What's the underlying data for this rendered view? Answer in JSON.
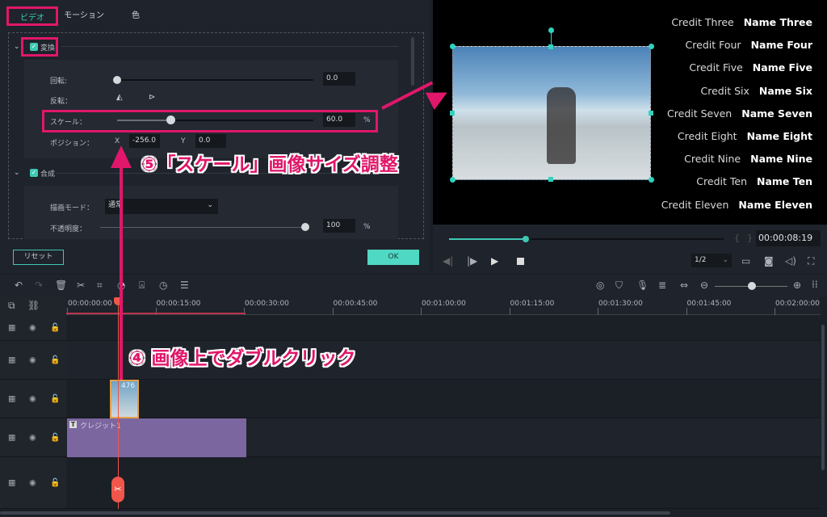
{
  "tabs": [
    "ビデオ",
    "モーション",
    "色"
  ],
  "transform": {
    "label": "変換",
    "rotation_label": "回転:",
    "rotation_value": "0.0",
    "flip_label": "反転：",
    "scale_label": "スケール：",
    "scale_value": "60.0",
    "scale_unit": "%",
    "scale_fraction": 0.31,
    "position_label": "ポジション：",
    "x_label": "X",
    "x_value": "-256.0",
    "y_label": "Y",
    "y_value": "0.0"
  },
  "composite": {
    "label": "合成",
    "blend_label": "描画モード：",
    "blend_value": "通常",
    "opacity_label": "不透明度：",
    "opacity_value": "100",
    "opacity_unit": "%"
  },
  "buttons": {
    "reset": "リセット",
    "ok": "OK"
  },
  "credits": [
    [
      "Credit Three",
      "Name  Three"
    ],
    [
      "Credit Four",
      "Name  Four"
    ],
    [
      "Credit Five",
      "Name  Five"
    ],
    [
      "Credit Six",
      "Name  Six"
    ],
    [
      "Credit Seven",
      "Name  Seven"
    ],
    [
      "Credit Eight",
      "Name  Eight"
    ],
    [
      "Credit Nine",
      "Name  Nine"
    ],
    [
      "Credit Ten",
      "Name  Ten"
    ],
    [
      "Credit Eleven",
      "Name  Eleven"
    ]
  ],
  "player": {
    "timecode": "00:00:08:19",
    "quality": "1/2",
    "progress_fraction": 0.28
  },
  "ruler": [
    "00:00:00:00",
    "00:00:15:00",
    "00:00:30:00",
    "00:00:45:00",
    "00:01:00:00",
    "00:01:15:00",
    "00:01:30:00",
    "00:01:45:00",
    "00:02:00:00"
  ],
  "clips": {
    "image_label": "476",
    "title_clip": "クレジット1"
  },
  "annotations": {
    "step5": "⑤「スケール」画像サイズ調整",
    "step4": "④ 画像上でダブルクリック"
  },
  "colors": {
    "accent": "#3fc8b4",
    "annotation": "#e0176a",
    "title_clip": "#7b66a0",
    "playhead": "#f0564a"
  }
}
